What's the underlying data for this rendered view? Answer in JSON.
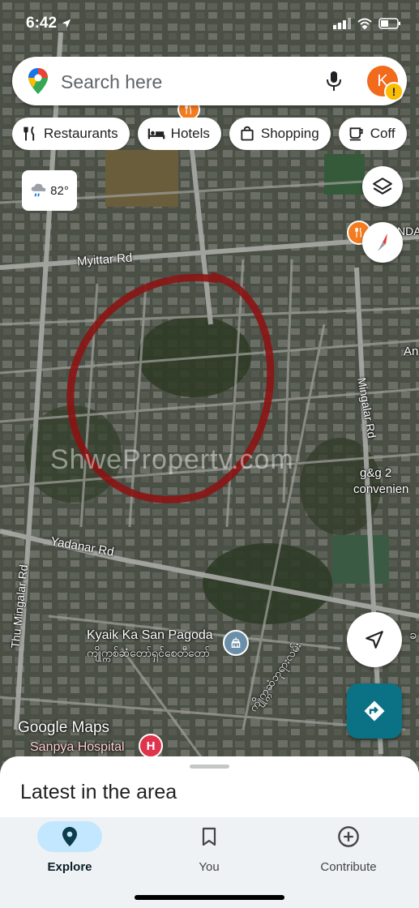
{
  "status_bar": {
    "time": "6:42"
  },
  "search": {
    "placeholder": "Search here",
    "avatar_letter": "K"
  },
  "chips": [
    {
      "icon": "restaurant-icon",
      "label": "Restaurants"
    },
    {
      "icon": "hotel-icon",
      "label": "Hotels"
    },
    {
      "icon": "shopping-bag-icon",
      "label": "Shopping"
    },
    {
      "icon": "coffee-icon",
      "label": "Coff"
    }
  ],
  "weather": {
    "temperature": "82°",
    "icon": "cloud-rain-icon"
  },
  "map": {
    "roads": {
      "myittar": "Myittar Rd",
      "mingalar": "Mingalar Rd",
      "yadanar": "Yadanar Rd",
      "thu_mingalar": "Thu Mingalar Rd",
      "burmese_road": "ကျိုက္ကဆံဘုရားလမ်း",
      "an": "An",
      "nda": "NDA"
    },
    "places": {
      "pagoda_en": "Kyaik Ka San Pagoda",
      "pagoda_my": "ကျိုက္ကစ်ဆံတော်ရှင်စေတီတော်",
      "hospital": "Sanpya Hospital",
      "gg_line1": "g&g 2",
      "gg_line2": "convenien",
      "burmese_right": "ခ"
    },
    "watermark": "ShwePropertv.com",
    "google_logo": "Google Maps",
    "hospital_badge": "H"
  },
  "bottom_sheet": {
    "title": "Latest in the area"
  },
  "nav": [
    {
      "label": "Explore",
      "icon": "location-pin-icon",
      "active": true
    },
    {
      "label": "You",
      "icon": "bookmark-icon",
      "active": false
    },
    {
      "label": "Contribute",
      "icon": "add-circle-icon",
      "active": false
    }
  ],
  "colors": {
    "accent": "#0b7285",
    "active_pill": "#c2e7ff",
    "poi_orange": "#f47b20",
    "hospital_red": "#e0334c",
    "circle_red": "#8b1414"
  }
}
